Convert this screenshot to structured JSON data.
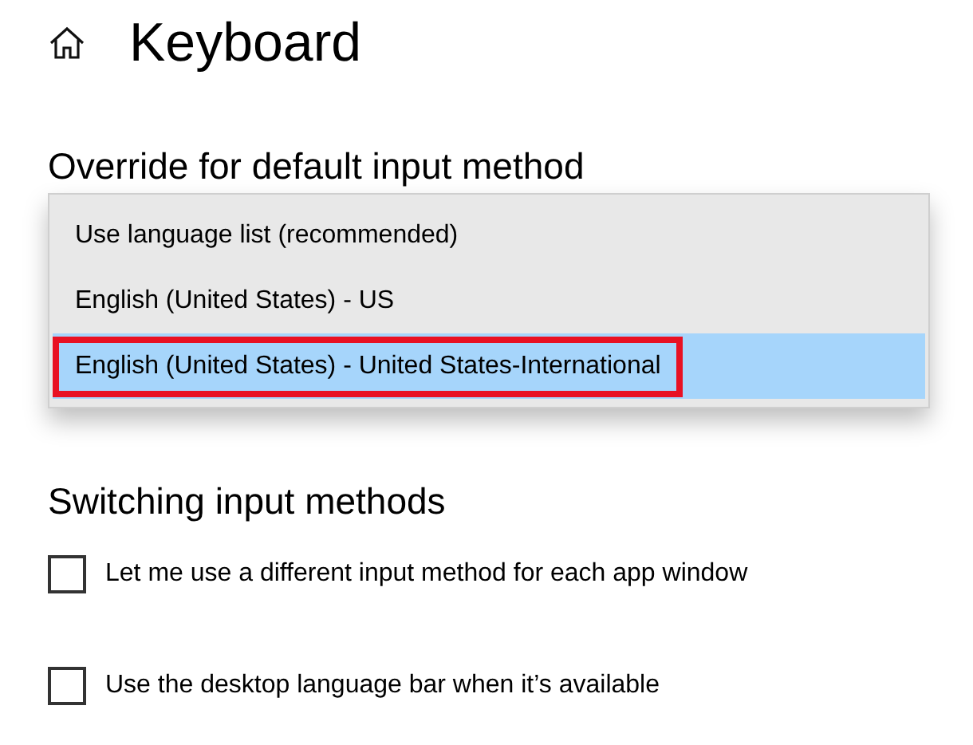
{
  "page": {
    "title": "Keyboard"
  },
  "override": {
    "heading": "Override for default input method",
    "options": [
      {
        "label": "Use language list (recommended)",
        "selected": false,
        "highlighted": false
      },
      {
        "label": "English (United States) - US",
        "selected": false,
        "highlighted": false
      },
      {
        "label": "English (United States) - United States-International",
        "selected": true,
        "highlighted": true
      }
    ]
  },
  "switching": {
    "heading": "Switching input methods",
    "options": [
      {
        "label": "Let me use a different input method for each app window",
        "checked": false
      },
      {
        "label": "Use the desktop language bar when it’s available",
        "checked": false
      }
    ]
  }
}
